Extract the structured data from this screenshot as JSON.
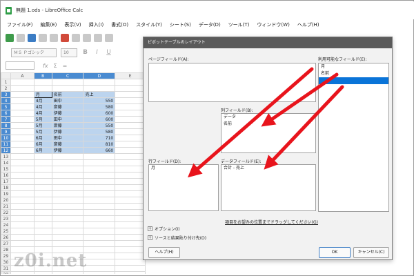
{
  "window": {
    "title": "無題 1.ods - LibreOffice Calc"
  },
  "menu": [
    "ファイル(F)",
    "編集(E)",
    "表示(V)",
    "挿入(I)",
    "書式(O)",
    "スタイル(Y)",
    "シート(S)",
    "データ(D)",
    "ツール(T)",
    "ウィンドウ(W)",
    "ヘルプ(H)"
  ],
  "toolbar": {
    "font_name": "ＭＳ Ｐゴシック",
    "font_size": "10",
    "bold": "B",
    "italic": "I",
    "underline": "U",
    "sigma": "Σ",
    "equals": "="
  },
  "formula": {
    "fx": "fx"
  },
  "sheet": {
    "columns": [
      "",
      "A",
      "B",
      "C",
      "D",
      "E"
    ],
    "rows": [
      {
        "n": "1",
        "cells": [
          "",
          "",
          "",
          ""
        ]
      },
      {
        "n": "2",
        "cells": [
          "",
          "",
          "",
          ""
        ]
      },
      {
        "n": "3",
        "cells": [
          "",
          "月",
          "名前",
          "売上"
        ]
      },
      {
        "n": "4",
        "cells": [
          "",
          "4月",
          "田中",
          "550"
        ]
      },
      {
        "n": "5",
        "cells": [
          "",
          "4月",
          "斎藤",
          "580"
        ]
      },
      {
        "n": "6",
        "cells": [
          "",
          "4月",
          "伊藤",
          "600"
        ]
      },
      {
        "n": "7",
        "cells": [
          "",
          "5月",
          "田中",
          "600"
        ]
      },
      {
        "n": "8",
        "cells": [
          "",
          "5月",
          "斎藤",
          "550"
        ]
      },
      {
        "n": "9",
        "cells": [
          "",
          "5月",
          "伊藤",
          "580"
        ]
      },
      {
        "n": "10",
        "cells": [
          "",
          "6月",
          "田中",
          "710"
        ]
      },
      {
        "n": "11",
        "cells": [
          "",
          "6月",
          "斎藤",
          "810"
        ]
      },
      {
        "n": "12",
        "cells": [
          "",
          "6月",
          "伊藤",
          "660"
        ]
      },
      {
        "n": "13",
        "cells": [
          "",
          "",
          "",
          ""
        ]
      },
      {
        "n": "14",
        "cells": [
          "",
          "",
          "",
          ""
        ]
      },
      {
        "n": "15",
        "cells": [
          "",
          "",
          "",
          ""
        ]
      },
      {
        "n": "16",
        "cells": [
          "",
          "",
          "",
          ""
        ]
      },
      {
        "n": "17",
        "cells": [
          "",
          "",
          "",
          ""
        ]
      },
      {
        "n": "18",
        "cells": [
          "",
          "",
          "",
          ""
        ]
      },
      {
        "n": "19",
        "cells": [
          "",
          "",
          "",
          ""
        ]
      },
      {
        "n": "20",
        "cells": [
          "",
          "",
          "",
          ""
        ]
      },
      {
        "n": "21",
        "cells": [
          "",
          "",
          "",
          ""
        ]
      },
      {
        "n": "22",
        "cells": [
          "",
          "",
          "",
          ""
        ]
      },
      {
        "n": "23",
        "cells": [
          "",
          "",
          "",
          ""
        ]
      },
      {
        "n": "24",
        "cells": [
          "",
          "",
          "",
          ""
        ]
      },
      {
        "n": "25",
        "cells": [
          "",
          "",
          "",
          ""
        ]
      },
      {
        "n": "26",
        "cells": [
          "",
          "",
          "",
          ""
        ]
      },
      {
        "n": "27",
        "cells": [
          "",
          "",
          "",
          ""
        ]
      },
      {
        "n": "28",
        "cells": [
          "",
          "",
          "",
          ""
        ]
      },
      {
        "n": "29",
        "cells": [
          "",
          "",
          "",
          ""
        ]
      },
      {
        "n": "30",
        "cells": [
          "",
          "",
          "",
          ""
        ]
      },
      {
        "n": "31",
        "cells": [
          "",
          "",
          "",
          ""
        ]
      },
      {
        "n": "32",
        "cells": [
          "",
          "",
          "",
          ""
        ]
      }
    ]
  },
  "dialog": {
    "title": "ピボットテーブルのレイアウト",
    "page_fields_label": "ページフィールド(A):",
    "available_fields_label": "利用可能なフィールド(E):",
    "available_fields": [
      "月",
      "名前",
      ""
    ],
    "column_fields_label": "列フィールド(B):",
    "column_fields": [
      "データ",
      "名前"
    ],
    "row_fields_label": "行フィールド(D):",
    "row_fields": [
      "月"
    ],
    "data_fields_label": "データフィールド(E):",
    "data_fields": [
      "合計 - 売上"
    ],
    "drag_hint": "項目をお望みの位置までドラッグしてください(G)",
    "options_label": "オプション(I)",
    "source_label": "ソースと結果貼り付け先(O)",
    "help_button": "ヘルプ(H)",
    "ok_button": "OK",
    "cancel_button": "キャンセル(C)"
  },
  "colors": {
    "arrow": "#e8141c",
    "selection": "#0a74d8",
    "selected_cells": "#bcd4ee"
  },
  "watermark": "z0i.net"
}
